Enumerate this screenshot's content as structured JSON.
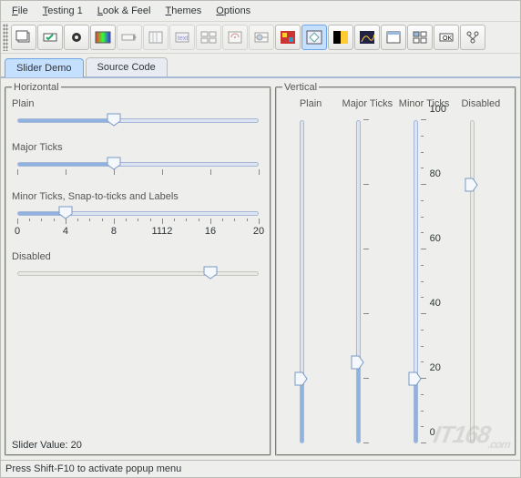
{
  "menubar": [
    {
      "label": "File",
      "u": 0
    },
    {
      "label": "Testing 1",
      "u": 0
    },
    {
      "label": "Look & Feel",
      "u": 0
    },
    {
      "label": "Themes",
      "u": 0
    },
    {
      "label": "Options",
      "u": 0
    }
  ],
  "tabs": {
    "slider_demo": "Slider Demo",
    "source_code": "Source Code"
  },
  "groups": {
    "horizontal": "Horizontal",
    "vertical": "Vertical"
  },
  "hsliders": {
    "plain": {
      "label": "Plain",
      "value": 40,
      "max": 100
    },
    "major": {
      "label": "Major Ticks",
      "value": 40,
      "max": 100,
      "major_ticks": [
        0,
        20,
        40,
        60,
        80,
        100
      ]
    },
    "minor": {
      "label": "Minor Ticks, Snap-to-ticks and Labels",
      "value": 4,
      "max": 20,
      "major_ticks": [
        0,
        4,
        8,
        12,
        16,
        20
      ],
      "labels": [
        "0",
        "4",
        "8",
        "1112",
        "16",
        "20"
      ]
    },
    "disabled": {
      "label": "Disabled",
      "value": 80,
      "max": 100
    }
  },
  "vsliders": {
    "plain": {
      "label": "Plain",
      "value": 20,
      "max": 100
    },
    "major": {
      "label": "Major Ticks",
      "value": 25,
      "max": 100,
      "major_ticks": [
        0,
        20,
        40,
        60,
        80,
        100
      ]
    },
    "minor": {
      "label": "Minor Ticks",
      "value": 20,
      "max": 100,
      "major_ticks": [
        0,
        20,
        40,
        60,
        80,
        100
      ],
      "labels": [
        "0",
        "20",
        "40",
        "60",
        "80",
        "100"
      ],
      "minor_ticks": 5
    },
    "disabled": {
      "label": "Disabled",
      "value": 80,
      "max": 100
    }
  },
  "slider_value_label": "Slider Value: 20",
  "status": "Press Shift-F10 to activate popup menu",
  "watermark": "IT168"
}
